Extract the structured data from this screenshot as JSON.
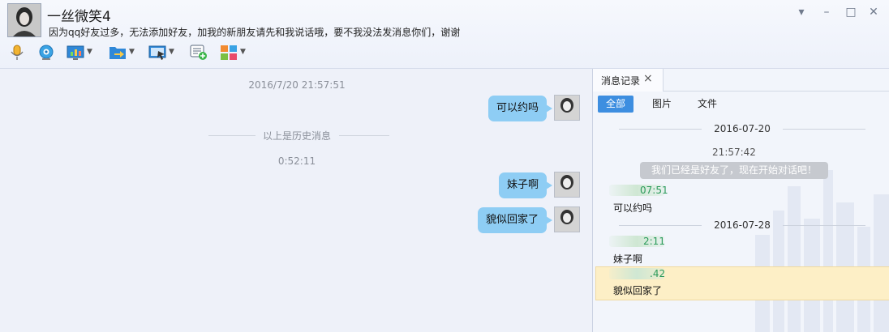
{
  "window": {
    "title": "一丝微笑4",
    "subtitle": "因为qq好友过多，无法添加好友，加我的新朋友请先和我说话哦，要不我没法发消息你们，谢谢",
    "controls": [
      "▾",
      "–",
      "□",
      "✕"
    ]
  },
  "toolbar": {
    "items": [
      {
        "name": "voice-call-button",
        "icon": "microphone-icon",
        "has_menu": false
      },
      {
        "name": "video-call-button",
        "icon": "webcam-icon",
        "has_menu": false
      },
      {
        "name": "remote-assist-button",
        "icon": "monitor-chart-icon",
        "has_menu": true
      },
      {
        "name": "file-transfer-button",
        "icon": "folder-arrow-icon",
        "has_menu": true
      },
      {
        "name": "screen-share-button",
        "icon": "screen-cursor-icon",
        "has_menu": true
      },
      {
        "name": "create-group-chat-button",
        "icon": "chat-add-icon",
        "has_menu": false
      },
      {
        "name": "apps-button",
        "icon": "apps-grid-icon",
        "has_menu": true
      }
    ]
  },
  "chat": {
    "timestamp_1": "2016/7/20 21:57:51",
    "history_divider": "以上是历史消息",
    "timestamp_2": "0:52:11",
    "messages": [
      "可以约吗",
      "妹子啊",
      "貌似回家了"
    ]
  },
  "history_panel": {
    "tab_label": "消息记录",
    "close": "×",
    "filters": [
      "全部",
      "图片",
      "文件"
    ],
    "date_1": "2016-07-20",
    "time_1": "21:57:42",
    "system_message": "我们已经是好友了，现在开始对话吧！",
    "entries": [
      {
        "time": "07:51",
        "text": "可以约吗"
      },
      {
        "time": "2:11",
        "text": "妹子啊"
      },
      {
        "time": ".42",
        "text": "貌似回家了"
      }
    ],
    "date_2": "2016-07-28"
  },
  "colors": {
    "bubble": "#8ecdf4",
    "accent": "#3d8ee0",
    "highlight": "#fdefc6",
    "time_green": "#2a9a5a"
  }
}
